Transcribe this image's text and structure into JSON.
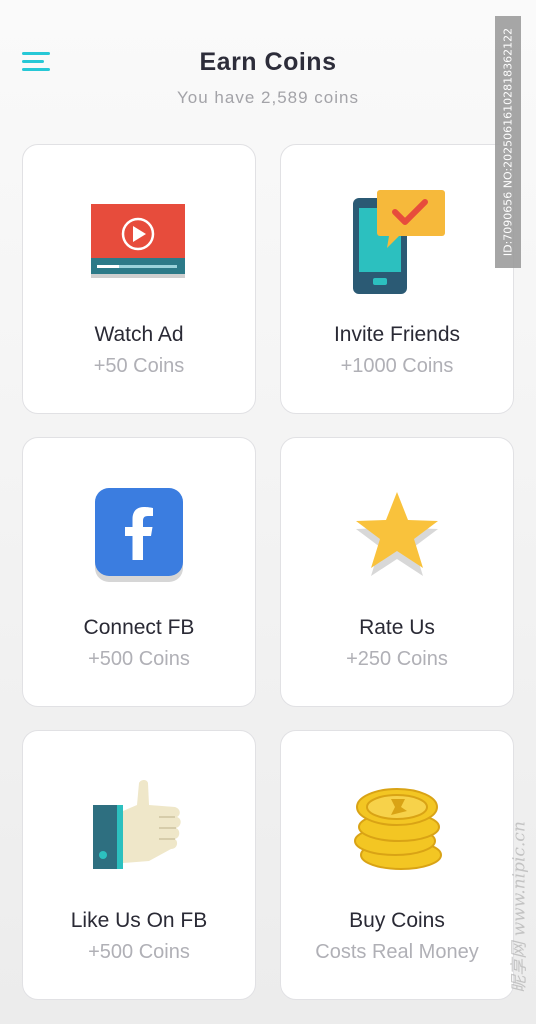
{
  "header": {
    "title": "Earn Coins",
    "subtitle": "You have 2,589 coins"
  },
  "cards": [
    {
      "label": "Watch Ad",
      "reward": "+50 Coins",
      "icon": "video-play-icon"
    },
    {
      "label": "Invite Friends",
      "reward": "+1000 Coins",
      "icon": "phone-message-icon"
    },
    {
      "label": "Connect FB",
      "reward": "+500 Coins",
      "icon": "facebook-icon"
    },
    {
      "label": "Rate Us",
      "reward": "+250 Coins",
      "icon": "star-icon"
    },
    {
      "label": "Like Us On FB",
      "reward": "+500 Coins",
      "icon": "thumbs-up-icon"
    },
    {
      "label": "Buy Coins",
      "reward": "Costs Real Money",
      "icon": "coin-stack-icon"
    }
  ],
  "watermarks": {
    "id_text": "ID:7090656 NO:20250616102818362122",
    "site_text": "昵享网 www.nipic.cn"
  },
  "colors": {
    "accent": "#27c8d6",
    "video_red": "#e74c3c",
    "facebook_blue": "#3b7de0",
    "star_yellow": "#f9c23c",
    "coin_gold": "#f3c623"
  }
}
